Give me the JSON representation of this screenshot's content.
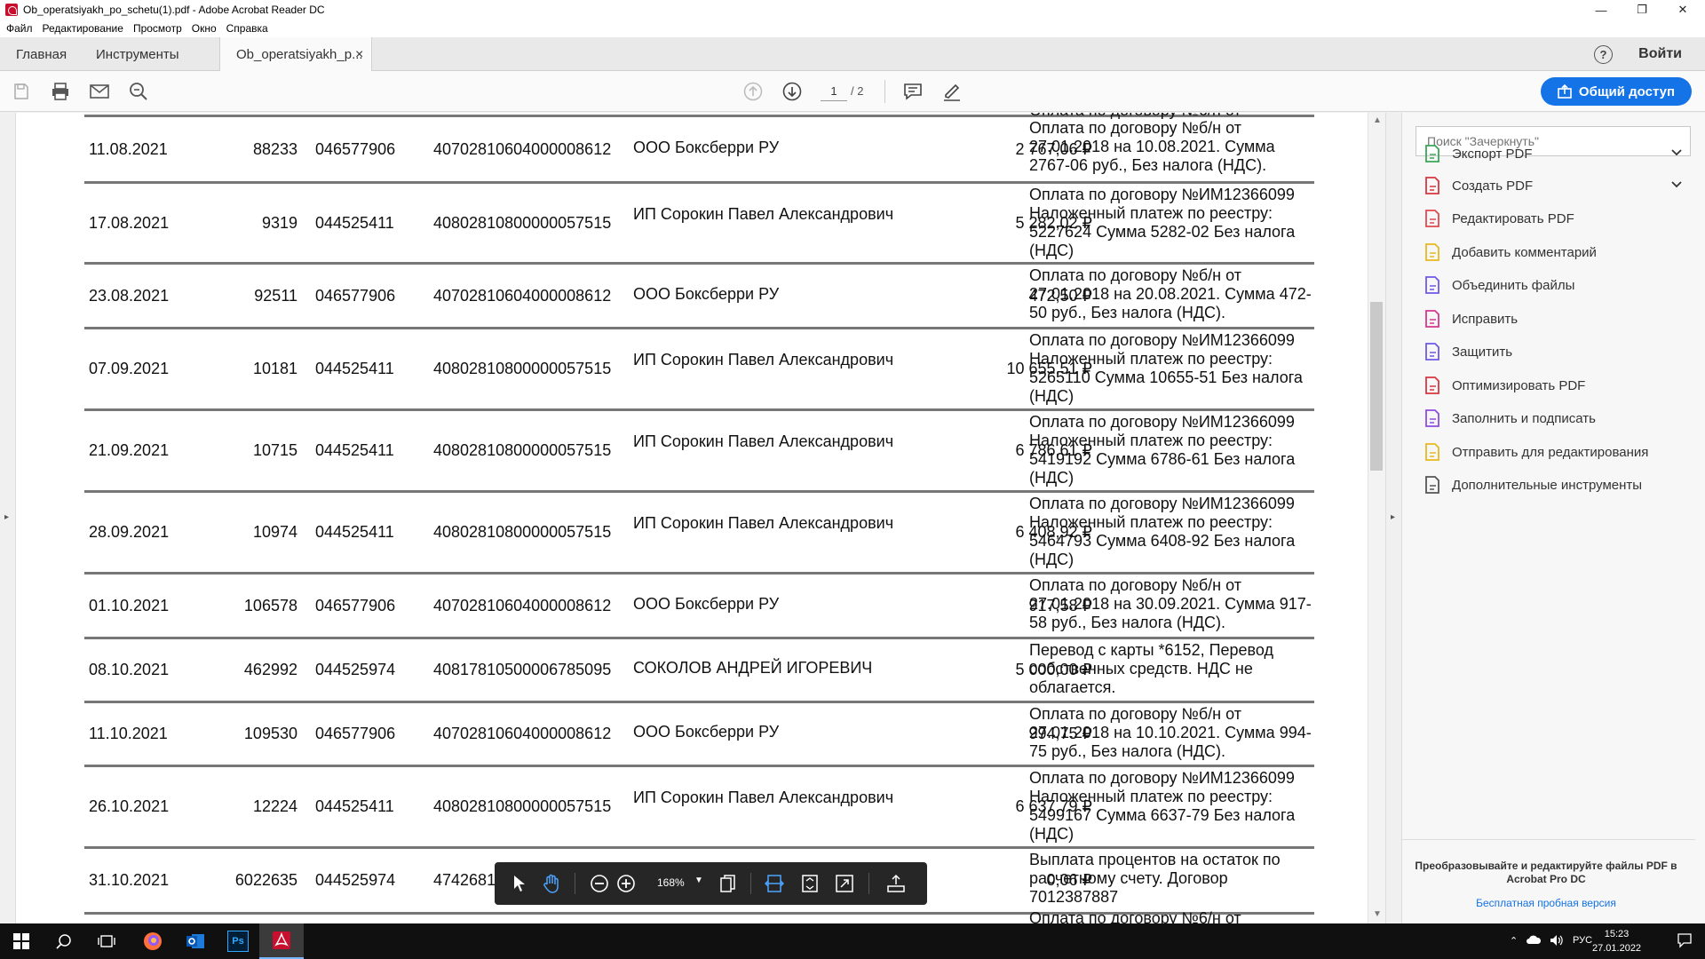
{
  "window": {
    "title": "Ob_operatsiyakh_po_schetu(1).pdf - Adobe Acrobat Reader DC",
    "minimize": "—",
    "restore": "❐",
    "close": "✕"
  },
  "menu": [
    "Файл",
    "Редактирование",
    "Просмотр",
    "Окно",
    "Справка"
  ],
  "tabs": {
    "home": "Главная",
    "tools": "Инструменты",
    "doc": "Ob_operatsiyakh_p...",
    "close": "×",
    "help": "?",
    "signin": "Войти"
  },
  "toolbar": {
    "page_current": "1",
    "page_total": "/ 2",
    "share_label": "Общий доступ"
  },
  "document": {
    "top_fragment": "Оплата по договору №6/н от",
    "bottom_fragment": "Оплата по договору №6/н от",
    "rows": [
      {
        "date": "11.08.2021",
        "num": "88233",
        "bik": "046577906",
        "account": "40702810604000008612",
        "name": "ООО Боксберри РУ",
        "amount": "2 767,06 ₽",
        "desc": "Оплата по договору №б/н от 27.01.2018 на 10.08.2021. Сумма 2767-06 руб., Без налога (НДС)."
      },
      {
        "date": "17.08.2021",
        "num": "9319",
        "bik": "044525411",
        "account": "40802810800000057515",
        "name": "ИП Сорокин Павел Александрович",
        "amount": "5 282,02 ₽",
        "desc": "Оплата по договору №ИМ12366099 Наложенный платеж по реестру: 5227624 Сумма 5282-02 Без налога (НДС)"
      },
      {
        "date": "23.08.2021",
        "num": "92511",
        "bik": "046577906",
        "account": "40702810604000008612",
        "name": "ООО Боксберри РУ",
        "amount": "472,50 ₽",
        "desc": "Оплата по договору №б/н от 27.01.2018 на 20.08.2021. Сумма 472-50 руб., Без налога (НДС)."
      },
      {
        "date": "07.09.2021",
        "num": "10181",
        "bik": "044525411",
        "account": "40802810800000057515",
        "name": "ИП Сорокин Павел Александрович",
        "amount": "10 655,51 ₽",
        "desc": "Оплата по договору №ИМ12366099 Наложенный платеж по реестру: 5265110 Сумма 10655-51 Без налога (НДС)"
      },
      {
        "date": "21.09.2021",
        "num": "10715",
        "bik": "044525411",
        "account": "40802810800000057515",
        "name": "ИП Сорокин Павел Александрович",
        "amount": "6 786,61 ₽",
        "desc": "Оплата по договору №ИМ12366099 Наложенный платеж по реестру: 5419192 Сумма 6786-61 Без налога (НДС)"
      },
      {
        "date": "28.09.2021",
        "num": "10974",
        "bik": "044525411",
        "account": "40802810800000057515",
        "name": "ИП Сорокин Павел Александрович",
        "amount": "6 408,92 ₽",
        "desc": "Оплата по договору №ИМ12366099 Наложенный платеж по реестру: 5464793 Сумма 6408-92 Без налога (НДС)"
      },
      {
        "date": "01.10.2021",
        "num": "106578",
        "bik": "046577906",
        "account": "40702810604000008612",
        "name": "ООО Боксберри РУ",
        "amount": "917,58 ₽",
        "desc": "Оплата по договору №б/н от 27.01.2018 на 30.09.2021. Сумма 917-58 руб., Без налога (НДС)."
      },
      {
        "date": "08.10.2021",
        "num": "462992",
        "bik": "044525974",
        "account": "40817810500006785095",
        "name": "СОКОЛОВ АНДРЕЙ ИГОРЕВИЧ",
        "amount": "5 000,00 ₽",
        "desc": "Перевод с карты *6152, Перевод собственных средств. НДС не облагается."
      },
      {
        "date": "11.10.2021",
        "num": "109530",
        "bik": "046577906",
        "account": "40702810604000008612",
        "name": "ООО Боксберри РУ",
        "amount": "994,75 ₽",
        "desc": "Оплата по договору №б/н от 27.01.2018 на 10.10.2021. Сумма 994-75 руб., Без налога (НДС)."
      },
      {
        "date": "26.10.2021",
        "num": "12224",
        "bik": "044525411",
        "account": "40802810800000057515",
        "name": "ИП Сорокин Павел Александрович",
        "amount": "6 637,79 ₽",
        "desc": "Оплата по договору №ИМ12366099 Наложенный платеж по реестру: 5499167 Сумма 6637-79 Без налога (НДС)"
      },
      {
        "date": "31.10.2021",
        "num": "6022635",
        "bik": "044525974",
        "account": "4742681",
        "name": "",
        "amount": "0,06 ₽",
        "desc": "Выплата процентов на остаток по расчетному счету. Договор 7012387887"
      }
    ]
  },
  "floatbar": {
    "zoom": "168%"
  },
  "rightpanel": {
    "search_placeholder": "Поиск \"Зачеркнуть\"",
    "tools": [
      {
        "label": "Экспорт PDF",
        "icon": "export-pdf-icon",
        "color": "#3aa657"
      },
      {
        "label": "Создать PDF",
        "icon": "create-pdf-icon",
        "color": "#d7373f"
      },
      {
        "label": "Редактировать PDF",
        "icon": "edit-pdf-icon",
        "color": "#e34850"
      },
      {
        "label": "Добавить комментарий",
        "icon": "comment-icon",
        "color": "#e8b81f"
      },
      {
        "label": "Объединить файлы",
        "icon": "combine-files-icon",
        "color": "#6e5ae6"
      },
      {
        "label": "Исправить",
        "icon": "fix-icon",
        "color": "#d83790"
      },
      {
        "label": "Защитить",
        "icon": "protect-icon",
        "color": "#6e5ae6"
      },
      {
        "label": "Оптимизировать PDF",
        "icon": "optimize-pdf-icon",
        "color": "#d7373f"
      },
      {
        "label": "Заполнить и подписать",
        "icon": "fill-sign-icon",
        "color": "#8e4de2"
      },
      {
        "label": "Отправить для редактирования",
        "icon": "send-for-review-icon",
        "color": "#e8b81f"
      },
      {
        "label": "Дополнительные инструменты",
        "icon": "more-tools-icon",
        "color": "#555555"
      }
    ],
    "promo_text": "Преобразовывайте и редактируйте файлы PDF в Acrobat Pro DC",
    "promo_link": "Бесплатная пробная версия"
  },
  "taskbar": {
    "lang": "РУС",
    "time": "15:23",
    "date": "27.01.2022"
  },
  "colors": {
    "accent": "#1473e6",
    "taskbar": "#101010"
  }
}
